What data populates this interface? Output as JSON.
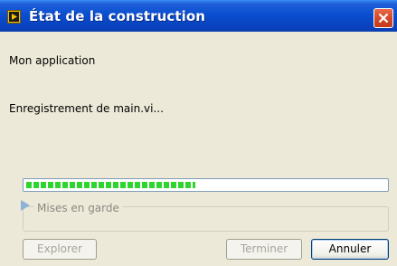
{
  "window": {
    "title": "État de la construction",
    "app_icon": "labview-build-icon",
    "close_icon": "close-icon"
  },
  "content": {
    "app_name": "Mon application",
    "status": "Enregistrement de main.vi..."
  },
  "progress": {
    "value": 0.47,
    "color": "#2fd52f"
  },
  "warnings": {
    "label": "Mises en garde",
    "expanded": false
  },
  "buttons": {
    "explore": "Explorer",
    "finish": "Terminer",
    "cancel": "Annuler"
  }
}
